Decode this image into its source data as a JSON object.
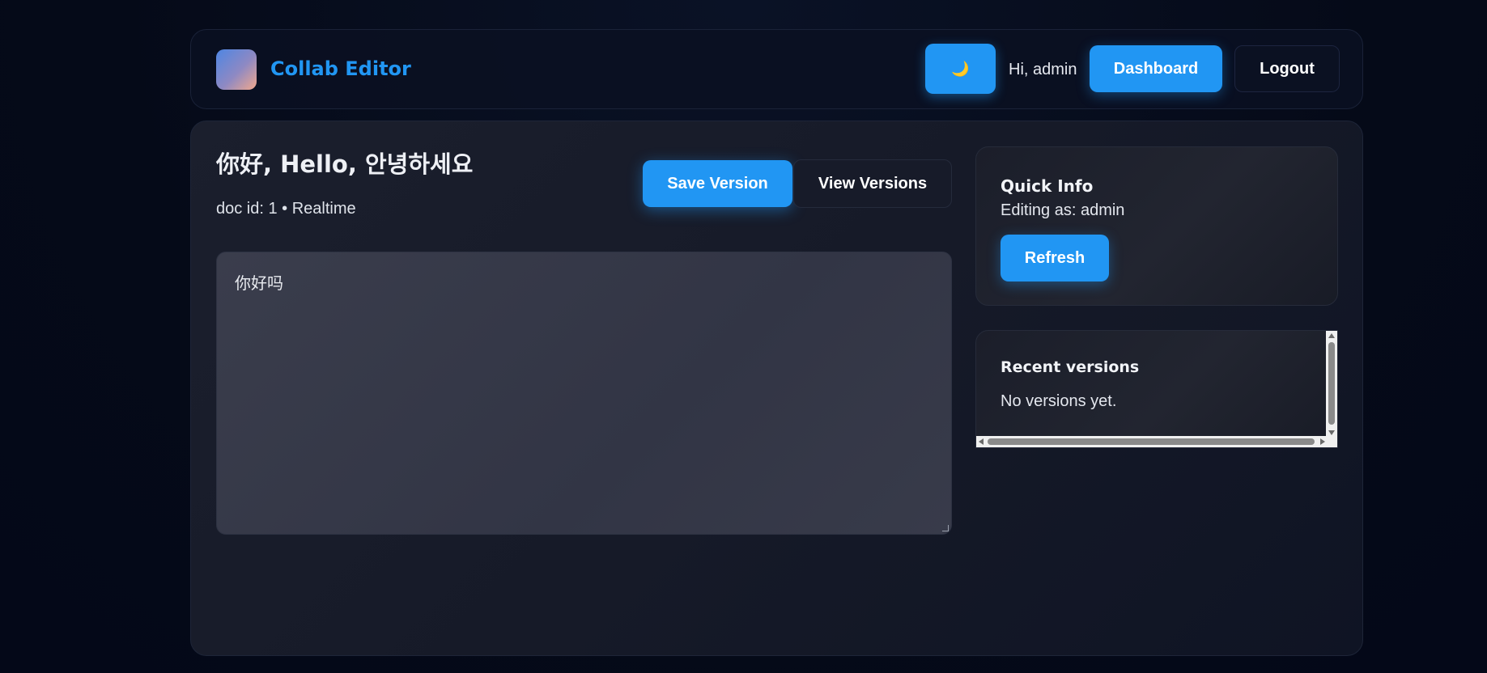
{
  "header": {
    "brand": "Collab Editor",
    "theme_icon": "🌙",
    "greeting": "Hi, admin",
    "dashboard_label": "Dashboard",
    "logout_label": "Logout"
  },
  "document": {
    "title": "你好, Hello, 안녕하세요",
    "meta": "doc id: 1 • Realtime",
    "content": "你好吗",
    "save_label": "Save Version",
    "view_label": "View Versions"
  },
  "quick_info": {
    "title": "Quick Info",
    "editing_as": "Editing as: admin",
    "refresh_label": "Refresh"
  },
  "versions": {
    "title": "Recent versions",
    "empty_text": "No versions yet."
  },
  "colors": {
    "accent": "#2196f3",
    "background": "#050a18"
  }
}
